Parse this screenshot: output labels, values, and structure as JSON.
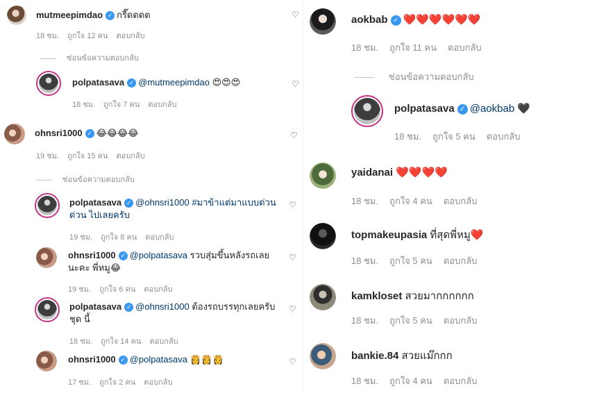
{
  "left": {
    "c1": {
      "user": "mutmeepimdao",
      "text": "กรี๊ดดดด",
      "time": "18 ชม.",
      "likes": "ถูกใจ 12 คน",
      "reply": "ตอบกลับ"
    },
    "hide1": "ซ่อนข้อความตอบกลับ",
    "r1": {
      "user": "polpatasava",
      "mention": "@mutmeepimdao",
      "text": "😍😍😍",
      "time": "18 ชม.",
      "likes": "ถูกใจ 7 คน",
      "reply": "ตอบกลับ"
    },
    "c2": {
      "user": "ohnsri1000",
      "text": "😂😂😂😂",
      "time": "19 ชม.",
      "likes": "ถูกใจ 15 คน",
      "reply": "ตอบกลับ"
    },
    "hide2": "ซ่อนข้อความตอบกลับ",
    "r2": {
      "user": "polpatasava",
      "mention": "@ohnsri1000",
      "text": "#มาข้าแต่มาแบบด่วน ด่วน ไปเลยครับ",
      "time": "19 ชม.",
      "likes": "ถูกใจ 8 คน",
      "reply": "ตอบกลับ"
    },
    "r3": {
      "user": "ohnsri1000",
      "mention": "@polpatasava",
      "text": "รวบสุ่มขึ้นหลังรถเลยนะคะ พี่หมู😂",
      "time": "19 ชม.",
      "likes": "ถูกใจ 6 คน",
      "reply": "ตอบกลับ"
    },
    "r4": {
      "user": "polpatasava",
      "mention": "@ohnsri1000",
      "text": "ต้องรถบรรทุกเลยครับชุด นี้",
      "time": "18 ชม.",
      "likes": "ถูกใจ 14 คน",
      "reply": "ตอบกลับ"
    },
    "r5": {
      "user": "ohnsri1000",
      "mention": "@polpatasava",
      "text": "👸👸👸",
      "time": "17 ชม.",
      "likes": "ถูกใจ 2 คน",
      "reply": "ตอบกลับ"
    }
  },
  "right": {
    "c1": {
      "user": "aokbab",
      "text": "❤️❤️❤️❤️❤️❤️",
      "time": "18 ชม.",
      "likes": "ถูกใจ 11 คน",
      "reply": "ตอบกลับ"
    },
    "hide1": "ซ่อนข้อความตอบกลับ",
    "r1": {
      "user": "polpatasava",
      "mention": "@aokbab",
      "text": "🖤",
      "time": "18 ชม.",
      "likes": "ถูกใจ 5 คน",
      "reply": "ตอบกลับ"
    },
    "c2": {
      "user": "yaidanai",
      "text": "❤️❤️❤️❤️",
      "time": "18 ชม.",
      "likes": "ถูกใจ 4 คน",
      "reply": "ตอบกลับ"
    },
    "c3": {
      "user": "topmakeupasia",
      "text": "ที่สุดพี่หมู❤️",
      "time": "18 ชม.",
      "likes": "ถูกใจ 5 คน",
      "reply": "ตอบกลับ"
    },
    "c4": {
      "user": "kamkloset",
      "text": "สวยมากกกกกก",
      "time": "18 ชม.",
      "likes": "ถูกใจ 5 คน",
      "reply": "ตอบกลับ"
    },
    "c5": {
      "user": "bankie.84",
      "text": "สวยแม๊กกก",
      "time": "18 ชม.",
      "likes": "ถูกใจ 4 คน",
      "reply": "ตอบกลับ"
    }
  },
  "icons": {
    "verified": "verified-badge-icon",
    "like": "heart-outline-icon"
  },
  "colors": {
    "verified": "#3897f0",
    "mention": "#00376b",
    "meta": "#8e8e8e",
    "ring": "#c13584"
  }
}
